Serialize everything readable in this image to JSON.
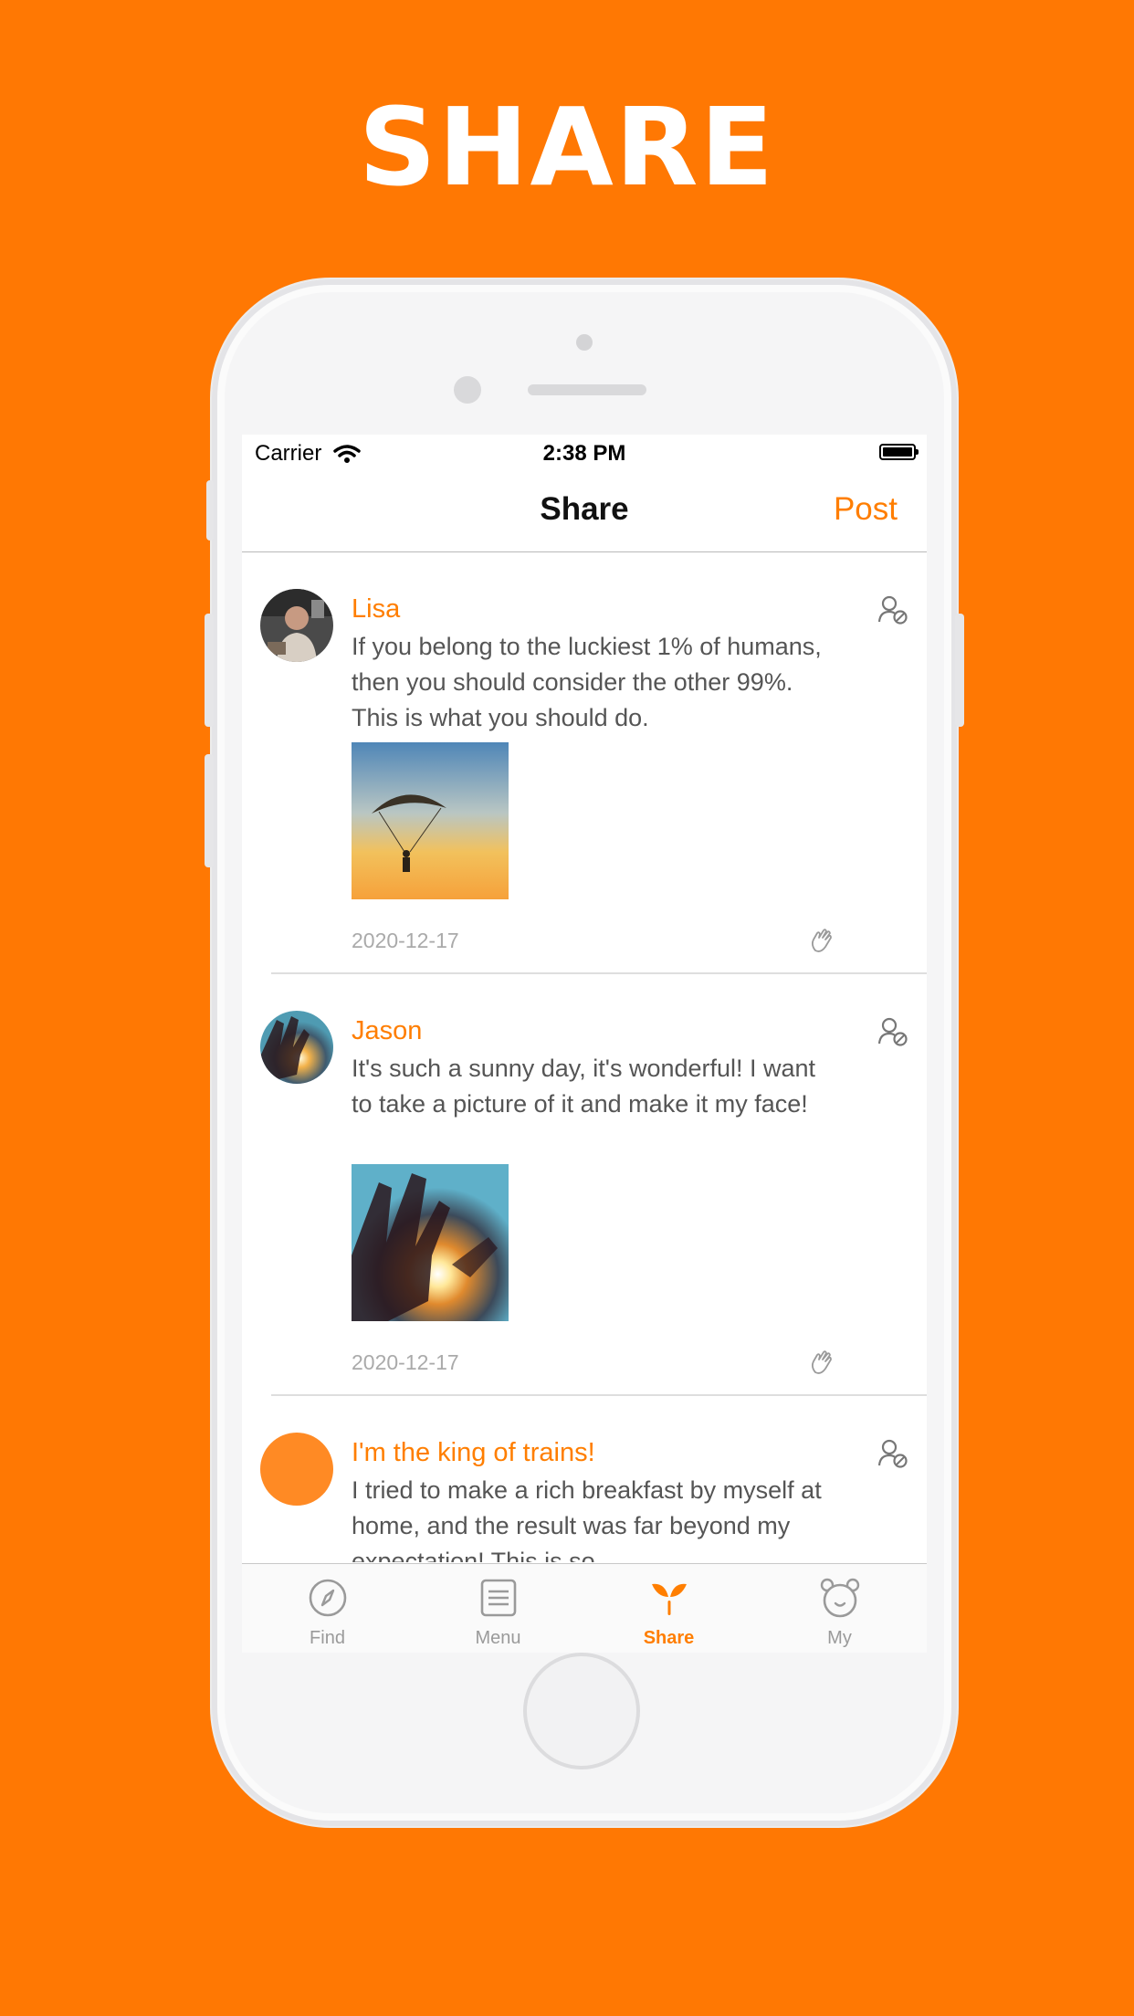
{
  "headline": "SHARE",
  "status_bar": {
    "carrier": "Carrier",
    "time": "2:38 PM"
  },
  "nav": {
    "title": "Share",
    "post_button": "Post"
  },
  "posts": [
    {
      "username": "Lisa",
      "text": "If you belong to the luckiest 1% of humans, then you should consider the other 99%. This is what you should do.",
      "date": "2020-12-17",
      "image": "parachute-sunset-photo"
    },
    {
      "username": "Jason",
      "text": "It's such a sunny day, it's wonderful! I want to take a picture of it and make it my face!",
      "date": "2020-12-17",
      "image": "hand-sunlight-photo"
    },
    {
      "username": "I'm the king of trains!",
      "text": "I tried to make a rich breakfast by myself at home, and the result was far beyond my expectation! This is so"
    }
  ],
  "tabs": [
    {
      "label": "Find",
      "icon": "compass-icon"
    },
    {
      "label": "Menu",
      "icon": "menu-list-icon"
    },
    {
      "label": "Share",
      "icon": "sprout-icon",
      "active": true
    },
    {
      "label": "My",
      "icon": "bear-face-icon"
    }
  ],
  "colors": {
    "background": "#FF7803",
    "accent": "#FF7E00"
  }
}
